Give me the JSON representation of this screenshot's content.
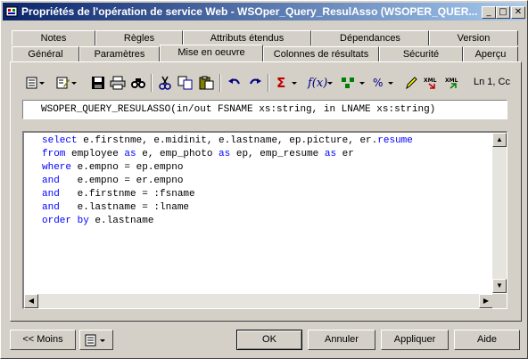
{
  "window": {
    "title": "Propriétés de l'opération de service Web - WSOper_Query_ResulAsso (WSOPER_QUER..."
  },
  "tabs": {
    "row1": [
      "Notes",
      "Règles",
      "Attributs étendus",
      "Dépendances",
      "Version"
    ],
    "row2": [
      "Général",
      "Paramètres",
      "Mise en oeuvre",
      "Colonnes de résultats",
      "Sécurité",
      "Aperçu"
    ],
    "active": "Mise en oeuvre"
  },
  "toolbar": {
    "position": "Ln 1, Cc",
    "icons": [
      "properties-icon",
      "edit-icon",
      "save-icon",
      "print-icon",
      "find-icon",
      "cut-icon",
      "copy-icon",
      "paste-icon",
      "undo-icon",
      "redo-icon",
      "sum-icon",
      "function-icon",
      "structure-icon",
      "percent-icon",
      "pencil-icon",
      "xml-import-icon",
      "xml-export-icon"
    ]
  },
  "signature": "WSOPER_QUERY_RESULASSO(in/out FSNAME xs:string, in LNAME xs:string)",
  "code": {
    "lines": [
      {
        "kw": "select",
        "rest": " e.firstnme, e.midinit, e.lastname, ep.picture, er.",
        "kw2": "resume",
        "rest2": ""
      },
      {
        "kw": "from",
        "rest": " employee ",
        "kw2": "as",
        "rest2": " e, emp_photo ",
        "kw3": "as",
        "rest3": " ep, emp_resume ",
        "kw4": "as",
        "rest4": " er"
      },
      {
        "kw": "where",
        "rest": " e.empno = ep.empno"
      },
      {
        "kw": "and",
        "rest": "   e.empno = er.empno"
      },
      {
        "kw": "and",
        "rest": "   e.firstnme = :fsname"
      },
      {
        "kw": "and",
        "rest": "   e.lastname = :lname"
      },
      {
        "kw": "order by",
        "rest": " e.lastname"
      }
    ]
  },
  "buttons": {
    "less": "<< Moins",
    "ok": "OK",
    "cancel": "Annuler",
    "apply": "Appliquer",
    "help": "Aide"
  }
}
